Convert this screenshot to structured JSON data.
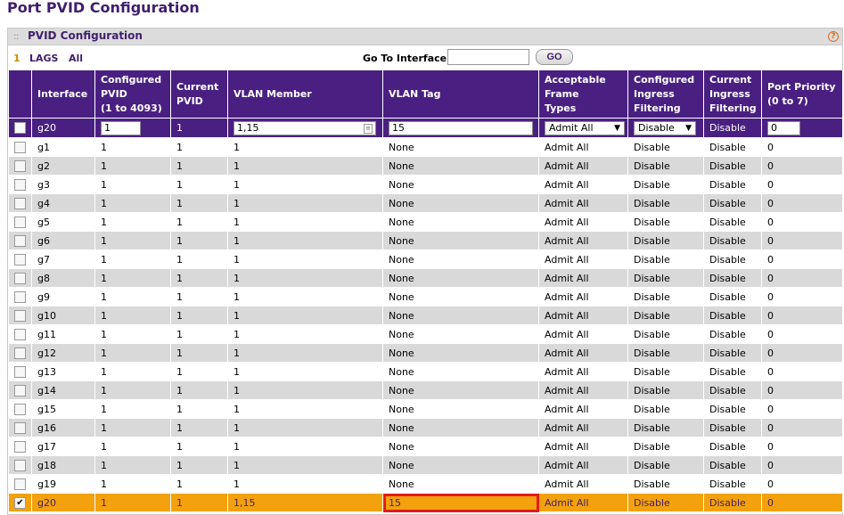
{
  "page_title": "Port PVID Configuration",
  "panel_title": "PVID Configuration",
  "filter": {
    "num": "1",
    "lags": "LAGS",
    "all": "All"
  },
  "goto": {
    "label": "Go To Interface",
    "value": "",
    "button": "GO"
  },
  "headers": {
    "interface": "Interface",
    "configured_pvid": [
      "Configured",
      "PVID",
      "(1 to 4093)"
    ],
    "current_pvid": [
      "Current",
      "PVID"
    ],
    "vlan_member": "VLAN Member",
    "vlan_tag": "VLAN Tag",
    "frame_types": [
      "Acceptable",
      "Frame",
      "Types"
    ],
    "configured_ingress": [
      "Configured",
      "Ingress",
      "Filtering"
    ],
    "current_ingress": [
      "Current",
      "Ingress",
      "Filtering"
    ],
    "port_priority": [
      "Port Priority",
      "(0 to 7)"
    ]
  },
  "edit_row": {
    "interface": "g20",
    "configured_pvid": "1",
    "current_pvid": "1",
    "vlan_member": "1,15",
    "vlan_tag": "15",
    "frame_types": "Admit All",
    "configured_ingress": "Disable",
    "current_ingress": "Disable",
    "port_priority": "0"
  },
  "rows": [
    {
      "interface": "g1",
      "configured_pvid": "1",
      "current_pvid": "1",
      "vlan_member": "1",
      "vlan_tag": "None",
      "frame_types": "Admit All",
      "configured_ingress": "Disable",
      "current_ingress": "Disable",
      "port_priority": "0",
      "checked": false
    },
    {
      "interface": "g2",
      "configured_pvid": "1",
      "current_pvid": "1",
      "vlan_member": "1",
      "vlan_tag": "None",
      "frame_types": "Admit All",
      "configured_ingress": "Disable",
      "current_ingress": "Disable",
      "port_priority": "0",
      "checked": false
    },
    {
      "interface": "g3",
      "configured_pvid": "1",
      "current_pvid": "1",
      "vlan_member": "1",
      "vlan_tag": "None",
      "frame_types": "Admit All",
      "configured_ingress": "Disable",
      "current_ingress": "Disable",
      "port_priority": "0",
      "checked": false
    },
    {
      "interface": "g4",
      "configured_pvid": "1",
      "current_pvid": "1",
      "vlan_member": "1",
      "vlan_tag": "None",
      "frame_types": "Admit All",
      "configured_ingress": "Disable",
      "current_ingress": "Disable",
      "port_priority": "0",
      "checked": false
    },
    {
      "interface": "g5",
      "configured_pvid": "1",
      "current_pvid": "1",
      "vlan_member": "1",
      "vlan_tag": "None",
      "frame_types": "Admit All",
      "configured_ingress": "Disable",
      "current_ingress": "Disable",
      "port_priority": "0",
      "checked": false
    },
    {
      "interface": "g6",
      "configured_pvid": "1",
      "current_pvid": "1",
      "vlan_member": "1",
      "vlan_tag": "None",
      "frame_types": "Admit All",
      "configured_ingress": "Disable",
      "current_ingress": "Disable",
      "port_priority": "0",
      "checked": false
    },
    {
      "interface": "g7",
      "configured_pvid": "1",
      "current_pvid": "1",
      "vlan_member": "1",
      "vlan_tag": "None",
      "frame_types": "Admit All",
      "configured_ingress": "Disable",
      "current_ingress": "Disable",
      "port_priority": "0",
      "checked": false
    },
    {
      "interface": "g8",
      "configured_pvid": "1",
      "current_pvid": "1",
      "vlan_member": "1",
      "vlan_tag": "None",
      "frame_types": "Admit All",
      "configured_ingress": "Disable",
      "current_ingress": "Disable",
      "port_priority": "0",
      "checked": false
    },
    {
      "interface": "g9",
      "configured_pvid": "1",
      "current_pvid": "1",
      "vlan_member": "1",
      "vlan_tag": "None",
      "frame_types": "Admit All",
      "configured_ingress": "Disable",
      "current_ingress": "Disable",
      "port_priority": "0",
      "checked": false
    },
    {
      "interface": "g10",
      "configured_pvid": "1",
      "current_pvid": "1",
      "vlan_member": "1",
      "vlan_tag": "None",
      "frame_types": "Admit All",
      "configured_ingress": "Disable",
      "current_ingress": "Disable",
      "port_priority": "0",
      "checked": false
    },
    {
      "interface": "g11",
      "configured_pvid": "1",
      "current_pvid": "1",
      "vlan_member": "1",
      "vlan_tag": "None",
      "frame_types": "Admit All",
      "configured_ingress": "Disable",
      "current_ingress": "Disable",
      "port_priority": "0",
      "checked": false
    },
    {
      "interface": "g12",
      "configured_pvid": "1",
      "current_pvid": "1",
      "vlan_member": "1",
      "vlan_tag": "None",
      "frame_types": "Admit All",
      "configured_ingress": "Disable",
      "current_ingress": "Disable",
      "port_priority": "0",
      "checked": false
    },
    {
      "interface": "g13",
      "configured_pvid": "1",
      "current_pvid": "1",
      "vlan_member": "1",
      "vlan_tag": "None",
      "frame_types": "Admit All",
      "configured_ingress": "Disable",
      "current_ingress": "Disable",
      "port_priority": "0",
      "checked": false
    },
    {
      "interface": "g14",
      "configured_pvid": "1",
      "current_pvid": "1",
      "vlan_member": "1",
      "vlan_tag": "None",
      "frame_types": "Admit All",
      "configured_ingress": "Disable",
      "current_ingress": "Disable",
      "port_priority": "0",
      "checked": false
    },
    {
      "interface": "g15",
      "configured_pvid": "1",
      "current_pvid": "1",
      "vlan_member": "1",
      "vlan_tag": "None",
      "frame_types": "Admit All",
      "configured_ingress": "Disable",
      "current_ingress": "Disable",
      "port_priority": "0",
      "checked": false
    },
    {
      "interface": "g16",
      "configured_pvid": "1",
      "current_pvid": "1",
      "vlan_member": "1",
      "vlan_tag": "None",
      "frame_types": "Admit All",
      "configured_ingress": "Disable",
      "current_ingress": "Disable",
      "port_priority": "0",
      "checked": false
    },
    {
      "interface": "g17",
      "configured_pvid": "1",
      "current_pvid": "1",
      "vlan_member": "1",
      "vlan_tag": "None",
      "frame_types": "Admit All",
      "configured_ingress": "Disable",
      "current_ingress": "Disable",
      "port_priority": "0",
      "checked": false
    },
    {
      "interface": "g18",
      "configured_pvid": "1",
      "current_pvid": "1",
      "vlan_member": "1",
      "vlan_tag": "None",
      "frame_types": "Admit All",
      "configured_ingress": "Disable",
      "current_ingress": "Disable",
      "port_priority": "0",
      "checked": false
    },
    {
      "interface": "g19",
      "configured_pvid": "1",
      "current_pvid": "1",
      "vlan_member": "1",
      "vlan_tag": "None",
      "frame_types": "Admit All",
      "configured_ingress": "Disable",
      "current_ingress": "Disable",
      "port_priority": "0",
      "checked": false
    },
    {
      "interface": "g20",
      "configured_pvid": "1",
      "current_pvid": "1",
      "vlan_member": "1,15",
      "vlan_tag": "15",
      "frame_types": "Admit All",
      "configured_ingress": "Disable",
      "current_ingress": "Disable",
      "port_priority": "0",
      "checked": true,
      "selected": true
    }
  ],
  "colors": {
    "header_bg": "#4a1f82",
    "selected_row": "#f3a10c",
    "highlight_border": "#e31b1b",
    "alt_row": "#d9d9d9"
  }
}
